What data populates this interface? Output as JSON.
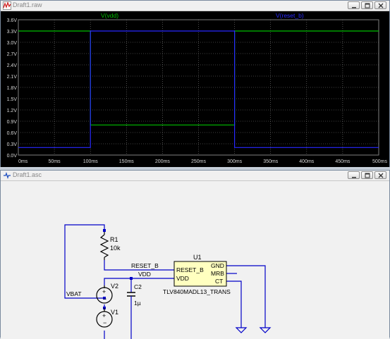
{
  "waveform_window": {
    "title": "Draft1.raw",
    "trace_labels": [
      "V(vdd)",
      "V(reset_b)"
    ]
  },
  "schematic_window": {
    "title": "Draft1.asc",
    "labels": {
      "r1_ref": "R1",
      "r1_val": "10k",
      "reset_b_net": "RESET_B",
      "vdd_net": "VDD",
      "v2": "V2",
      "c2_ref": "C2",
      "c2_val": "1µ",
      "v1": "V1",
      "vbat_net": "VBAT",
      "u1_ref": "U1",
      "u1_pin_reset_b": "RESET_B",
      "u1_pin_vdd": "VDD",
      "u1_pin_gnd": "GND",
      "u1_pin_mrb": "MRB",
      "u1_pin_ct": "CT",
      "u1_part": "TLV840MADL13_TRANS"
    }
  },
  "colors": {
    "plot_bg": "#000000",
    "grid": "#7f7f7f",
    "vdd_trace": "#00c000",
    "reset_trace": "#2828ff",
    "axis_text": "#d8d8d8",
    "wire": "#0000c8",
    "component": "#000000",
    "u1_fill": "#ffffc0",
    "junction": "#0000c8"
  },
  "chart_data": {
    "type": "line",
    "title": "",
    "xlabel": "",
    "ylabel": "",
    "x_ticks": [
      "0ms",
      "50ms",
      "100ms",
      "150ms",
      "200ms",
      "250ms",
      "300ms",
      "350ms",
      "400ms",
      "450ms",
      "500ms"
    ],
    "y_ticks": [
      "0.0V",
      "0.3V",
      "0.6V",
      "0.9V",
      "1.2V",
      "1.5V",
      "1.8V",
      "2.1V",
      "2.4V",
      "2.7V",
      "3.0V",
      "3.3V",
      "3.6V"
    ],
    "xlim": [
      0,
      500
    ],
    "ylim": [
      0,
      3.6
    ],
    "grid": true,
    "series": [
      {
        "name": "V(vdd)",
        "color": "#00c000",
        "x": [
          0,
          100,
          100,
          300,
          300,
          500
        ],
        "y": [
          3.3,
          3.3,
          0.8,
          0.8,
          3.3,
          3.3
        ]
      },
      {
        "name": "V(reset_b)",
        "color": "#2828ff",
        "x": [
          0,
          100,
          100,
          300,
          300,
          500
        ],
        "y": [
          0.2,
          0.2,
          3.3,
          3.3,
          0.2,
          0.2
        ]
      }
    ]
  }
}
